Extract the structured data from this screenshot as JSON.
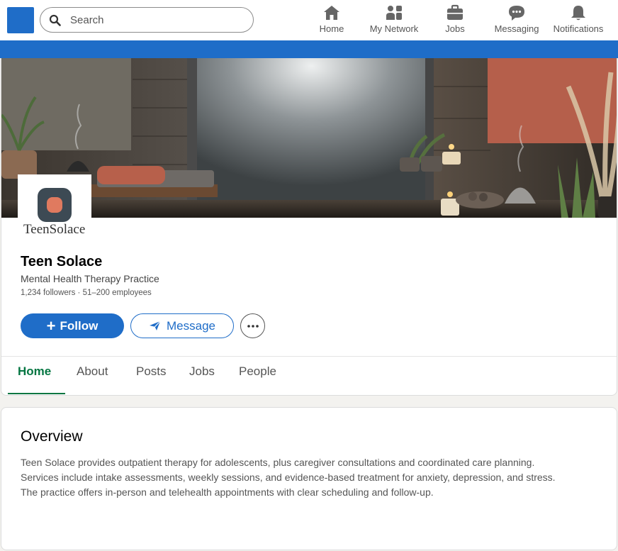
{
  "search": {
    "placeholder": "Search"
  },
  "nav": [
    {
      "label": "Home",
      "icon": "home-icon"
    },
    {
      "label": "My Network",
      "icon": "network-icon"
    },
    {
      "label": "Jobs",
      "icon": "briefcase-icon"
    },
    {
      "label": "Messaging",
      "icon": "chat-icon"
    },
    {
      "label": "Notifications",
      "icon": "bell-icon"
    }
  ],
  "company": {
    "logo_text": "TeenSolace",
    "name": "Teen Solace",
    "tagline": "Mental Health Therapy Practice",
    "meta": "1,234 followers · 51–200 employees"
  },
  "actions": {
    "follow": "Follow",
    "message": "Message"
  },
  "tabs": [
    "Home",
    "About",
    "Posts",
    "Jobs",
    "People"
  ],
  "overview": {
    "title": "Overview",
    "lines": [
      "Teen Solace provides outpatient therapy for adolescents, plus caregiver consultations and coordinated care planning.",
      "Services include intake assessments, weekly sessions, and evidence-based treatment for anxiety, depression, and stress.",
      "The practice offers in-person and telehealth appointments with clear scheduling and follow-up."
    ]
  },
  "colors": {
    "brand": "#1f6dc8",
    "active_tab": "#057642",
    "logo_mark": "#3d4a54",
    "logo_dot": "#e07a5f"
  }
}
